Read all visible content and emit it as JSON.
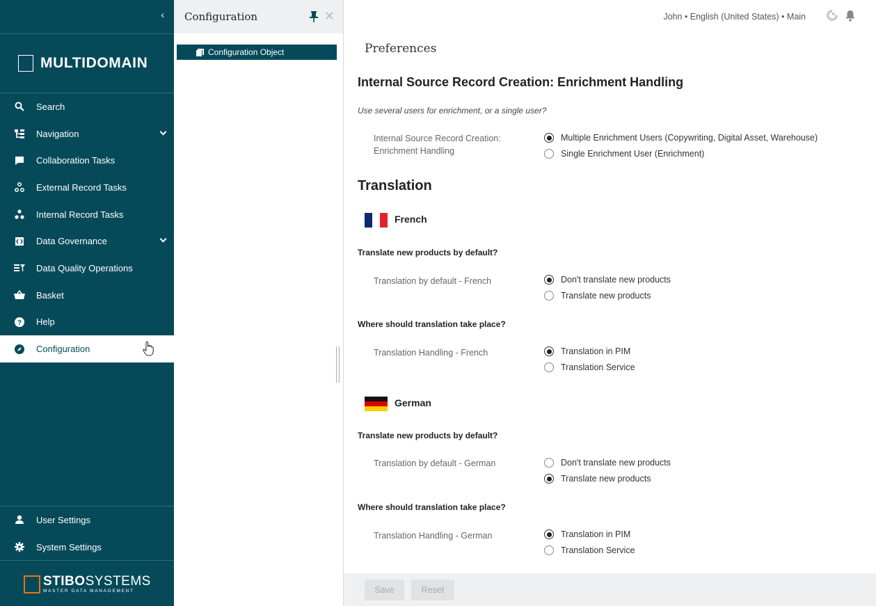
{
  "sidebar": {
    "logo_text": "MULTIDOMAIN",
    "items": [
      {
        "label": "Search",
        "icon": "search-icon"
      },
      {
        "label": "Navigation",
        "icon": "tree-icon"
      },
      {
        "label": "Collaboration Tasks",
        "icon": "chat-icon"
      },
      {
        "label": "External Record Tasks",
        "icon": "nodes-icon"
      },
      {
        "label": "Internal Record Tasks",
        "icon": "cluster-icon"
      },
      {
        "label": "Data Governance",
        "icon": "governance-icon"
      },
      {
        "label": "Data Quality Operations",
        "icon": "filter-list-icon"
      },
      {
        "label": "Basket",
        "icon": "basket-icon"
      },
      {
        "label": "Help",
        "icon": "help-icon"
      },
      {
        "label": "Configuration",
        "icon": "compass-icon"
      }
    ],
    "bottom_items": [
      {
        "label": "User Settings",
        "icon": "user-icon"
      },
      {
        "label": "System Settings",
        "icon": "gear-icon"
      }
    ],
    "brand_bold": "STIBO",
    "brand_light": "SYSTEMS",
    "brand_tagline": "MASTER DATA MANAGEMENT",
    "accent_color": "#064a5a",
    "brand_color": "#e8731a"
  },
  "panel": {
    "title": "Configuration",
    "selected_item": "Configuration Object"
  },
  "topbar": {
    "user_info": "John • English (United States) • Main"
  },
  "main": {
    "title": "Preferences",
    "section1": {
      "heading": "Internal Source Record Creation: Enrichment Handling",
      "question": "Use several users for enrichment, or a single user?",
      "label": "Internal Source Record Creation: Enrichment Handling",
      "options": [
        "Multiple Enrichment Users (Copywriting, Digital Asset, Warehouse)",
        "Single Enrichment User (Enrichment)"
      ],
      "selected": 0
    },
    "translation": {
      "heading": "Translation",
      "languages": [
        {
          "name": "French",
          "q1": "Translate new products by default?",
          "label1": "Translation by default - French",
          "options1": [
            "Don't translate new products",
            "Translate new products"
          ],
          "selected1": 0,
          "q2": "Where should translation take place?",
          "label2": "Translation Handling - French",
          "options2": [
            "Translation in PIM",
            "Translation Service"
          ],
          "selected2": 0
        },
        {
          "name": "German",
          "q1": "Translate new products by default?",
          "label1": "Translation by default - German",
          "options1": [
            "Don't translate new products",
            "Translate new products"
          ],
          "selected1": 1,
          "q2": "Where should translation take place?",
          "label2": "Translation Handling - German",
          "options2": [
            "Translation in PIM",
            "Translation Service"
          ],
          "selected2": 0
        }
      ]
    }
  },
  "footer": {
    "save_label": "Save",
    "reset_label": "Reset"
  }
}
